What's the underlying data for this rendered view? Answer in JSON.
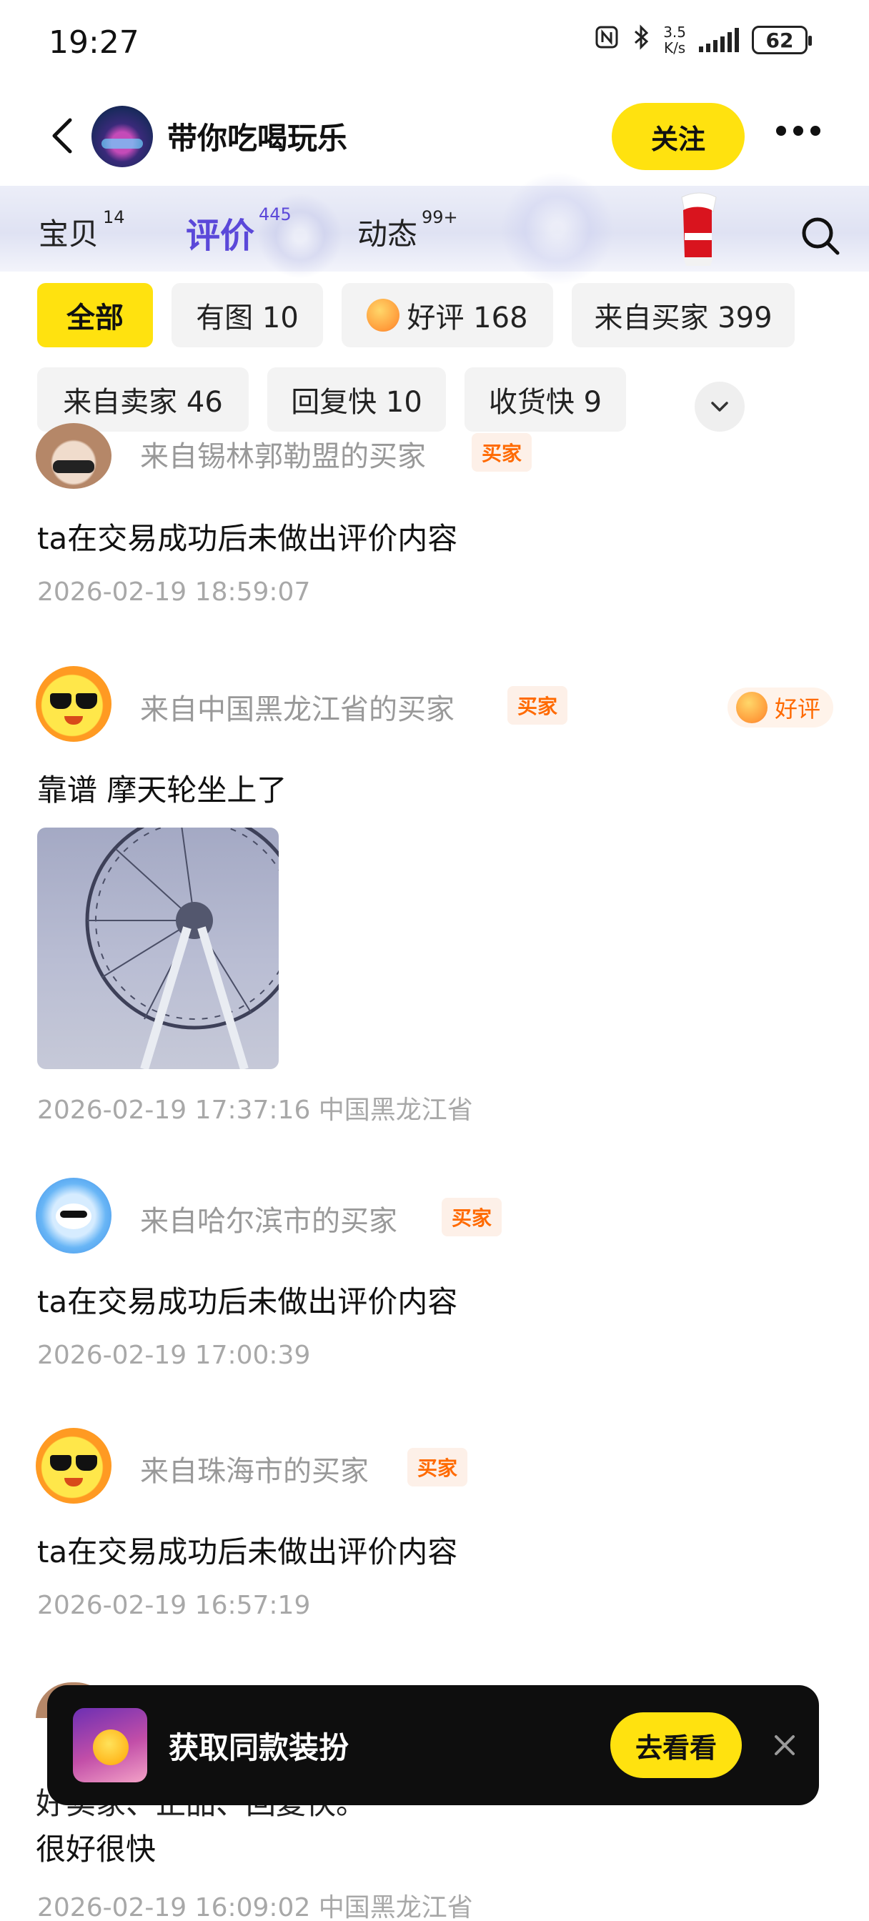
{
  "status_bar": {
    "time": "19:27",
    "net_speed_top": "3.5",
    "net_speed_unit": "K/s",
    "battery": "62"
  },
  "header": {
    "shop_name": "带你吃喝玩乐",
    "follow_label": "关注"
  },
  "tabs": [
    {
      "label": "宝贝",
      "count": "14"
    },
    {
      "label": "评价",
      "count": "445",
      "active": true
    },
    {
      "label": "动态",
      "count": "99+"
    }
  ],
  "filters": {
    "all": "全部",
    "with_pic": "有图 10",
    "good": "好评 168",
    "from_buyer": "来自买家 399",
    "from_seller": "来自卖家 46",
    "fast_reply": "回复快 10",
    "fast_receive": "收货快 9"
  },
  "reviews": [
    {
      "nickname": "来自锡林郭勒盟的买家",
      "tag": "买家",
      "content": "ta在交易成功后未做出评价内容",
      "meta": "2026-02-19 18:59:07"
    },
    {
      "nickname": "来自中国黑龙江省的买家",
      "tag": "买家",
      "badge": "好评",
      "content": "靠谱 摩天轮坐上了",
      "meta": "2026-02-19 17:37:16 中国黑龙江省"
    },
    {
      "nickname": "来自哈尔滨市的买家",
      "tag": "买家",
      "content": "ta在交易成功后未做出评价内容",
      "meta": "2026-02-19 17:00:39"
    },
    {
      "nickname": "来自珠海市的买家",
      "tag": "买家",
      "content": "ta在交易成功后未做出评价内容",
      "meta": "2026-02-19 16:57:19"
    }
  ],
  "partial_review": {
    "line1": "好卖家、正品、回复快。",
    "line2": "很好很快",
    "meta": "2026-02-19 16:09:02 中国黑龙江省"
  },
  "toast": {
    "title": "获取同款装扮",
    "action": "去看看"
  }
}
